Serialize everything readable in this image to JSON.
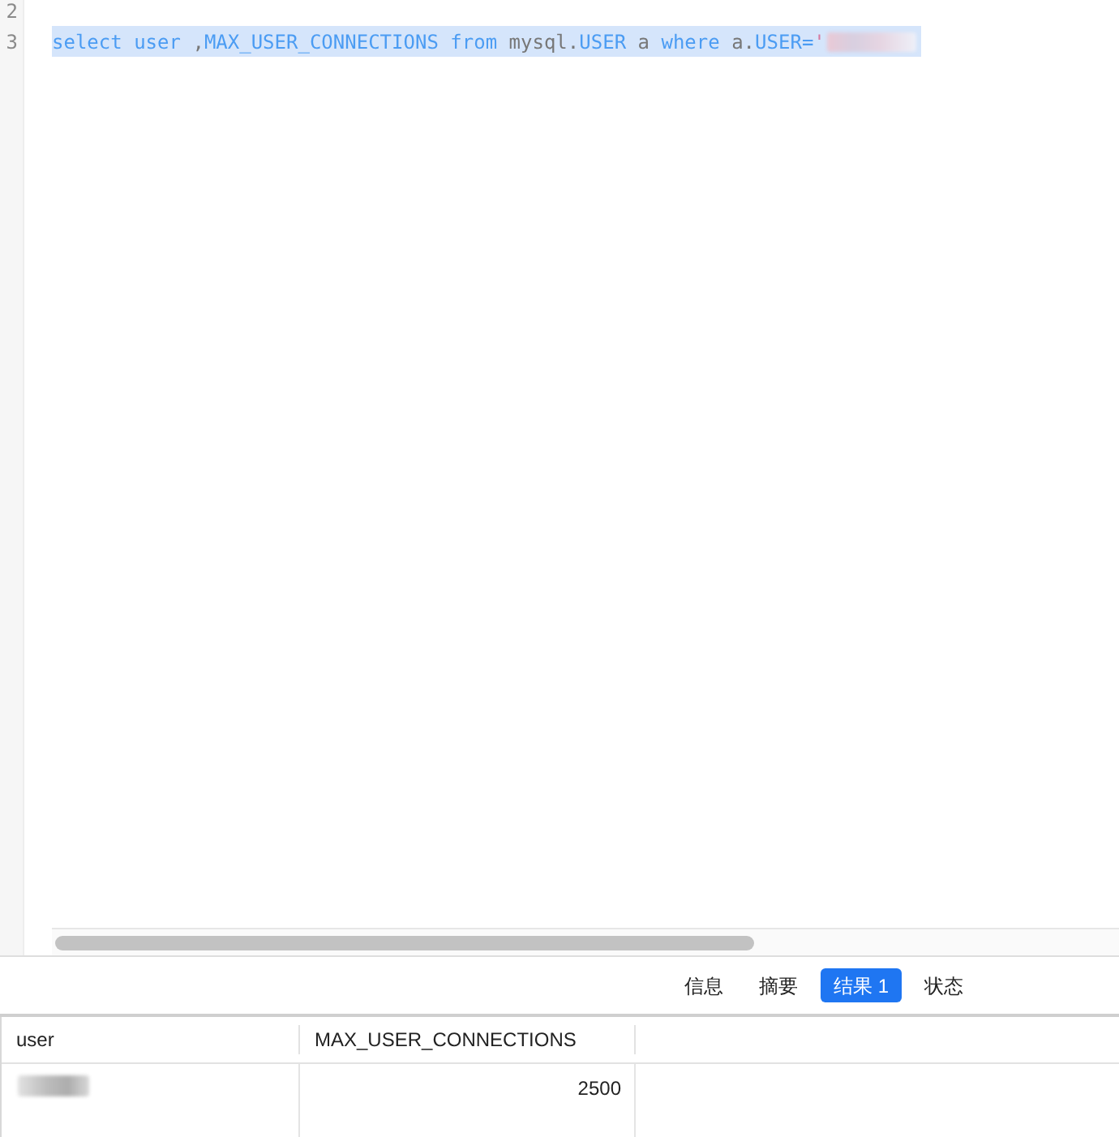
{
  "editor": {
    "lines": [
      {
        "number": "2"
      },
      {
        "number": "3",
        "selected": true,
        "tokens": [
          {
            "kind": "keyword",
            "text": "select user"
          },
          {
            "kind": "plain",
            "text": " ,"
          },
          {
            "kind": "keyword",
            "text": "MAX_USER_CONNECTIONS from"
          },
          {
            "kind": "plain",
            "text": " mysql."
          },
          {
            "kind": "keyword",
            "text": "USER"
          },
          {
            "kind": "plain",
            "text": " a "
          },
          {
            "kind": "keyword",
            "text": "where"
          },
          {
            "kind": "plain",
            "text": " a."
          },
          {
            "kind": "keyword",
            "text": "USER="
          },
          {
            "kind": "string",
            "text": "'"
          },
          {
            "kind": "redacted"
          }
        ]
      }
    ]
  },
  "result_tabs": [
    {
      "label": "信息",
      "selected": false
    },
    {
      "label": "摘要",
      "selected": false
    },
    {
      "label": "结果 1",
      "selected": true
    },
    {
      "label": "状态",
      "selected": false
    }
  ],
  "table": {
    "columns": [
      "user",
      "MAX_USER_CONNECTIONS"
    ],
    "rows": [
      {
        "cells": [
          {
            "kind": "redacted"
          },
          {
            "kind": "number",
            "text": "2500"
          }
        ]
      }
    ]
  }
}
